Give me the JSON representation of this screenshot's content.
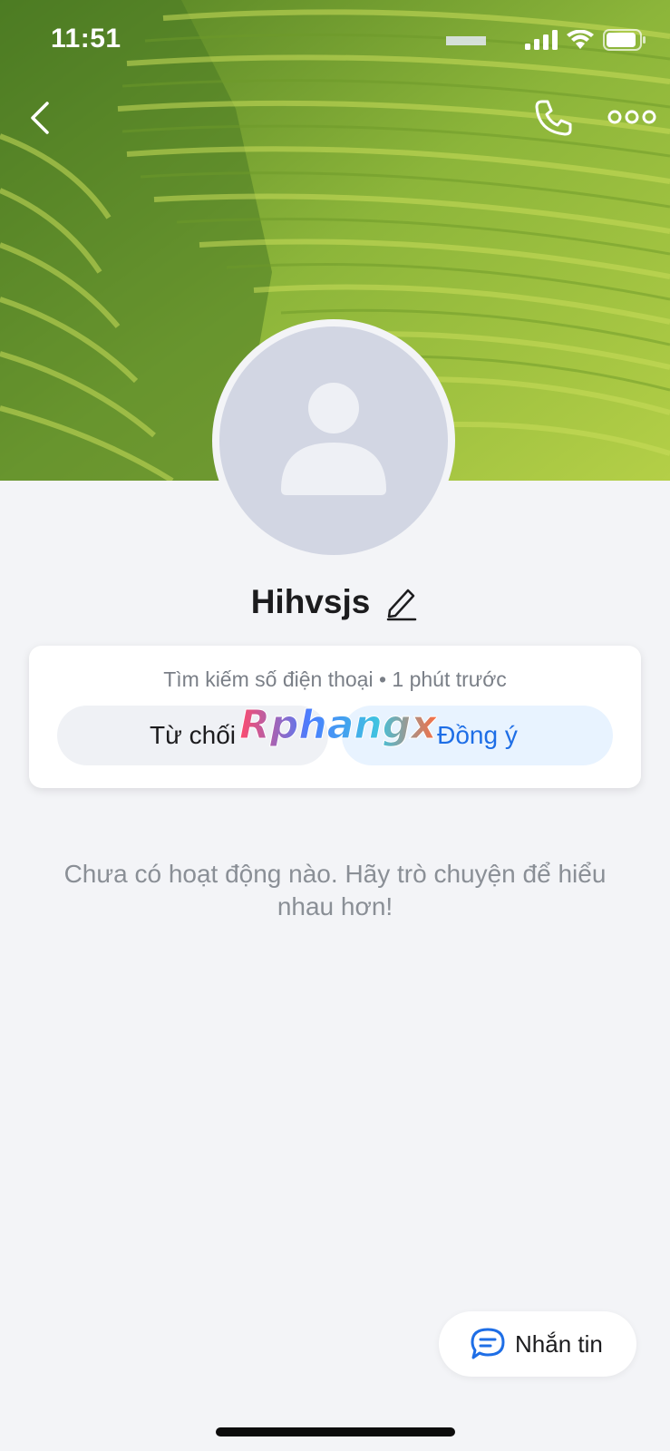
{
  "status_bar": {
    "time": "11:51"
  },
  "profile": {
    "name": "Hihvsjs"
  },
  "friend_request": {
    "info": "Tìm kiếm số điện thoại • 1 phút trước",
    "decline_label": "Từ chối",
    "accept_label": "Đồng ý",
    "watermark": "Rphangx"
  },
  "feed": {
    "empty_message": "Chưa có hoạt động nào. Hãy trò chuyện để hiểu nhau hơn!"
  },
  "actions": {
    "message_label": "Nhắn tin"
  },
  "colors": {
    "accent": "#1e6ee6",
    "background": "#f3f4f7"
  }
}
